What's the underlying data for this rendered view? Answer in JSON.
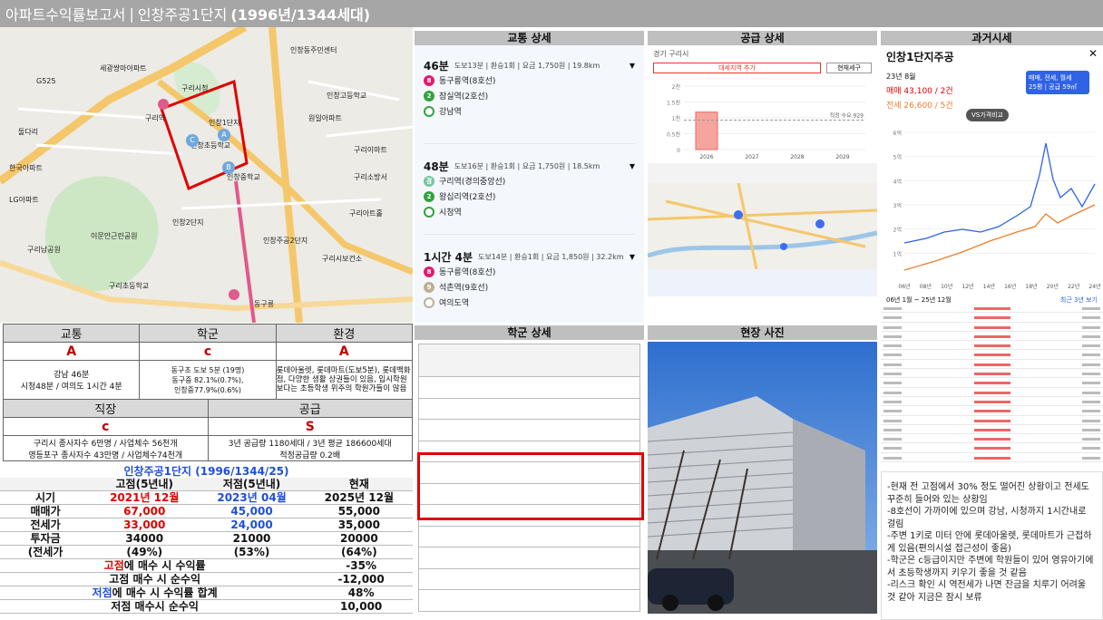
{
  "header": {
    "prefix": "아파트수익률보고서",
    "sep": "|",
    "title": "인창주공1단지",
    "years": "(1996년/1344세대)"
  },
  "map": {
    "labels": [
      "G525",
      "인창초등학교",
      "구리시청",
      "세광쌍마아파트",
      "인창중학교",
      "원일아파트",
      "구리역",
      "돌다리",
      "구리시보건소",
      "구리아트홀",
      "이문안근린공원",
      "인창1단지",
      "인창주공2단지",
      "구리소방서",
      "인창고등학교",
      "한국아파트",
      "구리초등학교",
      "LG아파트",
      "동구릉",
      "인창2단지",
      "구리이마트",
      "인창동주민센터",
      "구리남공원"
    ],
    "markers": [
      "C",
      "A",
      "B"
    ]
  },
  "traffic_table": {
    "headers": [
      "교통",
      "학군",
      "환경"
    ],
    "grades": [
      "A",
      "c",
      "A"
    ],
    "notes": [
      "강남 46분\n시청48분 / 여의도 1시간 4분",
      "동구초 도보 5분 (19명)\n동구중 82.1%(0.7%),\n인창중77.9%(0.6%)",
      "롯데아울렛, 롯데마트(도보5분), 롯데백화점, 다양한 생활 상권들이 있음, 입시학원보다는 초등학생 위주의 학원가들이 많음"
    ]
  },
  "work_table": {
    "headers": [
      "직장",
      "공급"
    ],
    "grades": [
      "c",
      "S"
    ],
    "notes": [
      "구리시 종사자수 6만명 / 사업체수 56천개\n영등포구 종사자수 43만명 / 사업체수74천개",
      "3년 공급량 1180세대 / 3년 평균 186600세대\n적정공급량 0.2배"
    ]
  },
  "profit": {
    "title": "인창주공1단지 (1996/1344/25)",
    "cols": [
      "",
      "고점(5년내)",
      "저점(5년내)",
      "현재"
    ],
    "rows": [
      {
        "label": "시기",
        "a": "2021년 12월",
        "b": "2023년 04월",
        "c": "2025년 12월"
      },
      {
        "label": "매매가",
        "a": "67,000",
        "b": "45,000",
        "c": "55,000"
      },
      {
        "label": "전세가",
        "a": "33,000",
        "b": "24,000",
        "c": "35,000"
      },
      {
        "label": "투자금",
        "a": "34000",
        "b": "21000",
        "c": "20000"
      },
      {
        "label": "(전세가",
        "a": "(49%)",
        "b": "(53%)",
        "c": "(64%)"
      }
    ],
    "summary": [
      {
        "pre": "고점",
        "text": "에 매수 시 수익률",
        "val": "-35%"
      },
      {
        "pre": "",
        "text": "고점 매수 시 순수익",
        "val": "-12,000"
      },
      {
        "pre": "저점",
        "text": "에 매수 시 수익률 합계",
        "val": "48%"
      },
      {
        "pre": "",
        "text": "저점 매수시 순수익",
        "val": "10,000"
      }
    ]
  },
  "transit": {
    "title": "교통 상세",
    "routes": [
      {
        "time": "46분",
        "info": "도보13분 | 환승1회 | 요금 1,750원 | 19.8km",
        "stops": [
          {
            "n": "8",
            "c": "#e6186c",
            "name": "동구릉역(8호선)"
          },
          {
            "n": "2",
            "c": "#33a23d",
            "name": "잠실역(2호선)"
          },
          {
            "n": "",
            "c": "#33a23d",
            "name": "강남역"
          }
        ]
      },
      {
        "time": "48분",
        "info": "도보16분 | 환승1회 | 요금 1,750원 | 18.5km",
        "stops": [
          {
            "n": "경",
            "c": "#77c4a3",
            "name": "구리역(경의중앙선)"
          },
          {
            "n": "2",
            "c": "#33a23d",
            "name": "왕십리역(2호선)"
          },
          {
            "n": "",
            "c": "#33a23d",
            "name": "시청역"
          }
        ]
      },
      {
        "time": "1시간 4분",
        "info": "도보14분 | 환승1회 | 요금 1,850원 | 32.2km",
        "stops": [
          {
            "n": "8",
            "c": "#e6186c",
            "name": "동구릉역(8호선)"
          },
          {
            "n": "9",
            "c": "#bdb092",
            "name": "석촌역(9호선)"
          },
          {
            "n": "",
            "c": "#bdb092",
            "name": "여의도역"
          }
        ]
      }
    ]
  },
  "supply": {
    "title": "공급 상세",
    "region": "경기 구리시",
    "btn1": "대세지역 추가",
    "btn2": "현재세구",
    "years": [
      "2026",
      "2027",
      "2028",
      "2029"
    ],
    "legend": "적정 수요 929",
    "yvals": [
      "2천",
      "1.5천",
      "1천",
      "0.5천",
      "0"
    ],
    "bar_value": 1180,
    "bar_max": 2000,
    "demand": 929
  },
  "price": {
    "title": "과거시세",
    "apt": "인창1단지주공",
    "date": "23년 8월",
    "sale": "매매 43,100 / 2건",
    "jeonse": "전세 26,600 / 5건",
    "vs": "VS가격비교",
    "filter1": "매매, 전세, 월세",
    "filter2": "25평 | 공급 59㎡",
    "years": [
      "06년",
      "08년",
      "10년",
      "12년",
      "14년",
      "16년",
      "18년",
      "20년",
      "22년",
      "24년"
    ],
    "yticks": [
      "6억",
      "5억",
      "4억",
      "3억",
      "2억",
      "1억"
    ],
    "period": "06년 1월 ~ 25년 12월",
    "link": "최근 3년 보기"
  },
  "school": {
    "title": "학군 상세"
  },
  "photo": {
    "title": "현장 사진"
  },
  "memo": {
    "lines": [
      "-현재 전 고점에서 30% 정도 떨어진 상황이고 전세도 꾸준히 들어와 있는 상황임",
      "-8호선이 가까이에 있으며 강남, 시청까지 1시간내로 걸림",
      "-주변 1키로 미터 안에 롯데아울렛, 롯데마트가 근접하게 있음(편의시설 접근성이 좋음)",
      "-학군은 c등급이지만 주변에 학원들이 있어 영유아기에서 초등학생까지 키우기 좋을 것 같음",
      "-리스크 확인 시 역전세가 나면 잔금을 치루기 어려울 것 같아 지금은 잠시 보류"
    ]
  }
}
